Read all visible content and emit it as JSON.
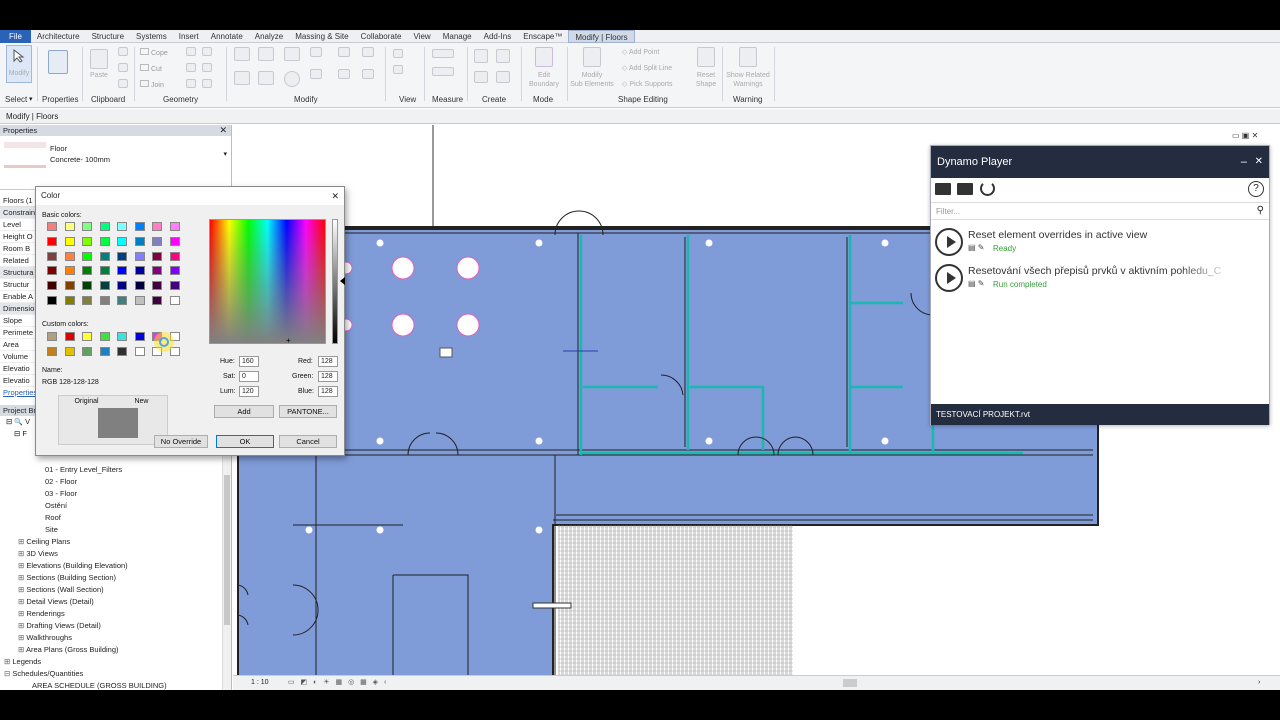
{
  "ribbon": {
    "tabs": [
      "File",
      "Architecture",
      "Structure",
      "Systems",
      "Insert",
      "Annotate",
      "Analyze",
      "Massing & Site",
      "Collaborate",
      "View",
      "Manage",
      "Add-Ins",
      "Enscape™",
      "Modify | Floors"
    ],
    "panels": {
      "select": "Select",
      "properties": "Properties",
      "clipboard": "Clipboard",
      "geometry": "Geometry",
      "modify": "Modify",
      "view": "View",
      "measure": "Measure",
      "create": "Create",
      "mode": "Mode",
      "shape_editing": "Shape Editing",
      "warning": "Warning"
    },
    "buttons": {
      "modify": "Modify",
      "paste": "Paste",
      "cope": "Cope",
      "cut": "Cut",
      "join": "Join",
      "edit_boundary_1": "Edit",
      "edit_boundary_2": "Boundary",
      "modify_sub_1": "Modify",
      "modify_sub_2": "Sub Elements",
      "add_point": "Add Point",
      "add_split_line": "Add Split Line",
      "pick_supports": "Pick Supports",
      "reset_shape_1": "Reset",
      "reset_shape_2": "Shape",
      "show_warnings_1": "Show Related",
      "show_warnings_2": "Warnings"
    }
  },
  "options_bar": {
    "context": "Modify | Floors"
  },
  "properties": {
    "header": "Properties",
    "family": "Floor",
    "type": "Concrete- 100mm",
    "filter_label": "Floors (1",
    "rows": [
      "Constrain",
      "Level",
      "Height O",
      "Room B",
      "Related",
      "Structura",
      "Structur",
      "Enable A",
      "Dimensio",
      "Slope",
      "Perimete",
      "Area",
      "Volume",
      "Elevatio",
      "Elevatio"
    ],
    "help_link": "Properties",
    "browser_header": "Project Br"
  },
  "browser": {
    "items": [
      "01 - Entry Level_Filters",
      "02 - Floor",
      "03 - Floor",
      "Ostění",
      "Roof",
      "Site"
    ],
    "groups": [
      "Ceiling Plans",
      "3D Views",
      "Elevations (Building Elevation)",
      "Sections (Building Section)",
      "Sections (Wall Section)",
      "Detail Views (Detail)",
      "Renderings",
      "Drafting Views (Detail)",
      "Walkthroughs",
      "Area Plans (Gross Building)",
      "Legends",
      "Schedules/Quantities",
      "AREA SCHEDULE (GROSS BUILDING)"
    ]
  },
  "color_dialog": {
    "title": "Color",
    "basic_label": "Basic colors:",
    "custom_label": "Custom colors:",
    "name_label": "Name:",
    "name_value": "RGB 128-128-128",
    "original_label": "Original",
    "new_label": "New",
    "hue_label": "Hue:",
    "hue": "160",
    "sat_label": "Sat:",
    "sat": "0",
    "lum_label": "Lum:",
    "lum": "120",
    "red_label": "Red:",
    "red": "128",
    "green_label": "Green:",
    "green": "128",
    "blue_label": "Blue:",
    "blue": "128",
    "add_btn": "Add",
    "pantone_btn": "PANTONE...",
    "no_override_btn": "No Override",
    "ok_btn": "OK",
    "cancel_btn": "Cancel",
    "basic_colors": [
      "#f08080",
      "#ffff80",
      "#80ff80",
      "#00ff80",
      "#80ffff",
      "#0080ff",
      "#ff80c0",
      "#ff80ff",
      "#ff0000",
      "#ffff00",
      "#80ff00",
      "#00ff40",
      "#00ffff",
      "#0080c0",
      "#8080c0",
      "#ff00ff",
      "#804040",
      "#ff8040",
      "#00ff00",
      "#008080",
      "#004080",
      "#8080ff",
      "#800040",
      "#ff0080",
      "#800000",
      "#ff8000",
      "#008000",
      "#008040",
      "#0000ff",
      "#0000a0",
      "#800080",
      "#8000ff",
      "#400000",
      "#804000",
      "#004000",
      "#004040",
      "#000080",
      "#000040",
      "#400040",
      "#400080",
      "#000000",
      "#808000",
      "#808040",
      "#808080",
      "#408080",
      "#c0c0c0",
      "#400040",
      "#ffffff"
    ],
    "custom_colors": [
      "#b0a080",
      "#e00000",
      "#ffff40",
      "#40e040",
      "#40e0e0",
      "#0000e0",
      "#e040e0",
      "#ffffff",
      "#c08020",
      "#e0c000",
      "#60a060",
      "#2080c0",
      "#303030",
      "#ffffff",
      "#ffffff",
      "#ffffff"
    ],
    "new_color": "#808080"
  },
  "dynamo": {
    "title": "Dynamo Player",
    "filter_placeholder": "Filter...",
    "graphs": [
      {
        "name": "Reset element overrides in active view",
        "status": "Ready"
      },
      {
        "name": "Resetování všech přepisů prvků v aktivním pohledu_C",
        "status": "Run completed"
      }
    ],
    "footer": "TESTOVACÍ PROJEKT.rvt",
    "status_color": "#3a9b3a"
  },
  "statusbar": {
    "scale": "1 : 10"
  }
}
